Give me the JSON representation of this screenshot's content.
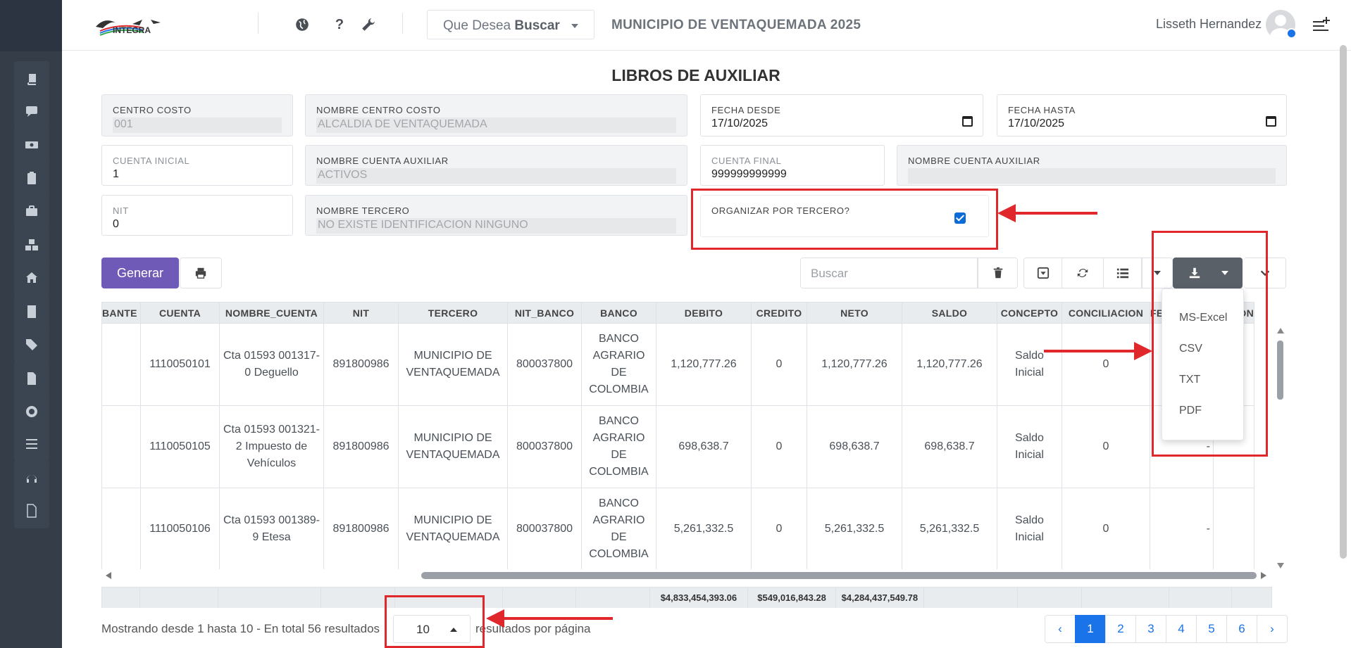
{
  "header": {
    "logo_text": "INTEGRA",
    "search_prefix": "Que Desea",
    "search_bold": "Buscar",
    "municipality": "MUNICIPIO DE VENTAQUEMADA 2025",
    "user_name": "Lisseth Hernandez",
    "icons": [
      "globe-icon",
      "help-icon",
      "wrench-icon",
      "menu-plus-icon"
    ]
  },
  "sidebar": {
    "items": [
      "book-icon",
      "comment-icon",
      "money-icon",
      "clipboard-icon",
      "briefcase-icon",
      "cubes-icon",
      "home-icon",
      "building-icon",
      "tags-icon",
      "file-icon",
      "lifebuoy-icon",
      "list-icon",
      "headphones-icon",
      "pdf-file-icon"
    ]
  },
  "page": {
    "title": "LIBROS DE AUXILIAR"
  },
  "form": {
    "centro_costo": {
      "label": "CENTRO COSTO",
      "value": "001"
    },
    "nombre_centro_costo": {
      "label": "NOMBRE CENTRO COSTO",
      "value": "ALCALDIA DE VENTAQUEMADA"
    },
    "fecha_desde": {
      "label": "FECHA DESDE",
      "value": "17/10/2025"
    },
    "fecha_hasta": {
      "label": "FECHA HASTA",
      "value": "17/10/2025"
    },
    "cuenta_inicial": {
      "label": "CUENTA INICIAL",
      "value": "1"
    },
    "nombre_cuenta_auxiliar_1": {
      "label": "NOMBRE CUENTA AUXILIAR",
      "value": "ACTIVOS"
    },
    "cuenta_final": {
      "label": "CUENTA FINAL",
      "value": "999999999999"
    },
    "nombre_cuenta_auxiliar_2": {
      "label": "NOMBRE CUENTA AUXILIAR",
      "value": ""
    },
    "nit": {
      "label": "NIT",
      "value": "0"
    },
    "nombre_tercero": {
      "label": "NOMBRE TERCERO",
      "value": "NO EXISTE IDENTIFICACION  NINGUNO"
    },
    "organizar": {
      "label": "ORGANIZAR POR TERCERO?",
      "checked": true
    }
  },
  "toolbar": {
    "generar_label": "Generar",
    "search_placeholder": "Buscar"
  },
  "export_menu": {
    "items": [
      "MS-Excel",
      "CSV",
      "TXT",
      "PDF"
    ]
  },
  "table": {
    "columns": [
      "BANTE",
      "CUENTA",
      "NOMBRE_CUENTA",
      "NIT",
      "TERCERO",
      "NIT_BANCO",
      "BANCO",
      "DEBITO",
      "CREDITO",
      "NETO",
      "SALDO",
      "CONCEPTO",
      "CONCILIACION",
      "FE",
      "ACION"
    ],
    "rows": [
      {
        "bante": "",
        "cuenta": "1110050101",
        "nombre_cuenta": "Cta 01593 001317-0 Deguello",
        "nit": "891800986",
        "tercero": "MUNICIPIO DE VENTAQUEMADA",
        "nit_banco": "800037800",
        "banco": "BANCO AGRARIO DE COLOMBIA",
        "debito": "1,120,777.26",
        "credito": "0",
        "neto": "1,120,777.26",
        "saldo": "1,120,777.26",
        "concepto": "Saldo Inicial",
        "conciliacion": "0",
        "fecha": ""
      },
      {
        "bante": "",
        "cuenta": "1110050105",
        "nombre_cuenta": "Cta 01593 001321-2 Impuesto de Vehículos",
        "nit": "891800986",
        "tercero": "MUNICIPIO DE VENTAQUEMADA",
        "nit_banco": "800037800",
        "banco": "BANCO AGRARIO DE COLOMBIA",
        "debito": "698,638.7",
        "credito": "0",
        "neto": "698,638.7",
        "saldo": "698,638.7",
        "concepto": "Saldo Inicial",
        "conciliacion": "0",
        "fecha": "-"
      },
      {
        "bante": "",
        "cuenta": "1110050106",
        "nombre_cuenta": "Cta 01593 001389-9 Etesa",
        "nit": "891800986",
        "tercero": "MUNICIPIO DE VENTAQUEMADA",
        "nit_banco": "800037800",
        "banco": "BANCO AGRARIO DE COLOMBIA",
        "debito": "5,261,332.5",
        "credito": "0",
        "neto": "5,261,332.5",
        "saldo": "5,261,332.5",
        "concepto": "Saldo Inicial",
        "conciliacion": "0",
        "fecha": "-"
      }
    ],
    "totals": {
      "debito": "$4,833,454,393.06",
      "credito": "$549,016,843.28",
      "neto": "$4,284,437,549.78"
    }
  },
  "pagination": {
    "summary": "Mostrando desde 1 hasta 10 - En total 56 resultados",
    "per_page": "10",
    "per_page_label": "resultados por página",
    "prev": "‹",
    "pages": [
      "1",
      "2",
      "3",
      "4",
      "5",
      "6"
    ],
    "next": "›",
    "active_page": "1"
  },
  "colors": {
    "primary": "#6f5bb7",
    "annotation": "#e0272b",
    "link": "#1a73e8",
    "sidebar": "#343d48"
  }
}
